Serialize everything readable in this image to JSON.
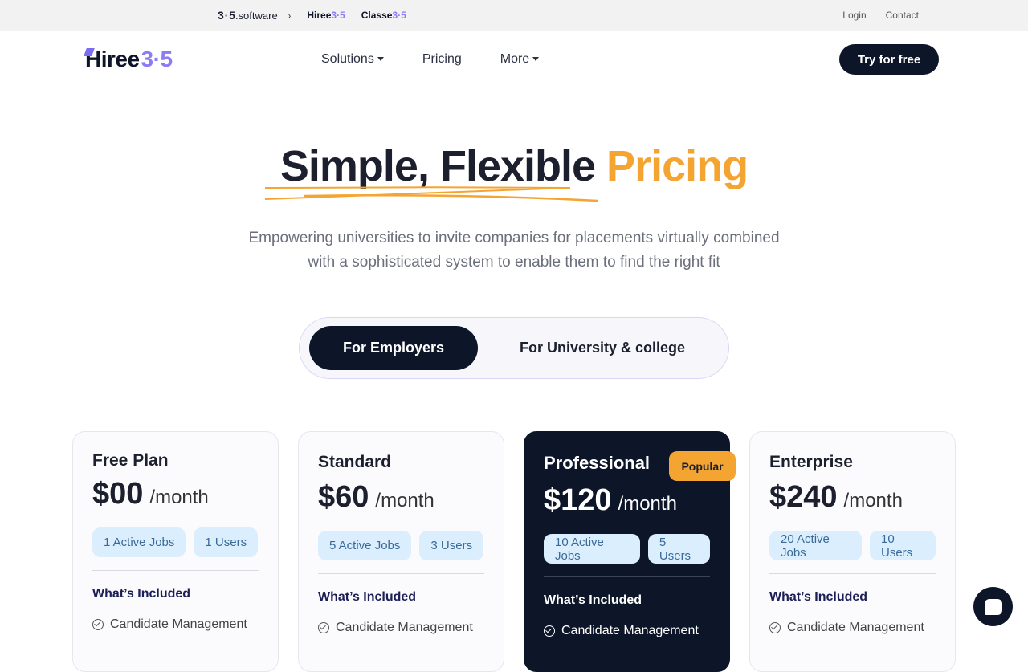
{
  "topbar": {
    "brand": {
      "digits_left": "3",
      "digits_right": "5",
      "suffix": ".software"
    },
    "chevron": "›",
    "products": [
      {
        "name": "Hiree",
        "suffix": "3·5"
      },
      {
        "name": "Classe",
        "suffix": "3·5"
      }
    ],
    "links": {
      "login": "Login",
      "contact": "Contact"
    }
  },
  "nav": {
    "logo": {
      "word": "Hiree",
      "digits": "3·5"
    },
    "menu": {
      "solutions": "Solutions",
      "pricing": "Pricing",
      "more": "More"
    },
    "cta": "Try for free"
  },
  "hero": {
    "title_main": "Simple, Flexible",
    "title_accent": "Pricing",
    "subtitle_line1": "Empowering universities to invite companies for placements virtually combined",
    "subtitle_line2": "with a sophisticated system to enable them to find the right fit"
  },
  "toggle": {
    "employers": "For Employers",
    "university": "For University & college"
  },
  "plans": [
    {
      "name": "Free Plan",
      "price": "$00",
      "period": "/month",
      "jobs": "1 Active Jobs",
      "users": "1 Users",
      "included": "What’s Included",
      "feature1": "Candidate Management"
    },
    {
      "name": "Standard",
      "price": "$60",
      "period": "/month",
      "jobs": "5 Active Jobs",
      "users": "3 Users",
      "included": "What’s Included",
      "feature1": "Candidate Management"
    },
    {
      "name": "Professional",
      "price": "$120",
      "period": "/month",
      "jobs": "10 Active Jobs",
      "users": "5 Users",
      "included": "What’s Included",
      "feature1": "Candidate Management",
      "badge": "Popular"
    },
    {
      "name": "Enterprise",
      "price": "$240",
      "period": "/month",
      "jobs": "20 Active Jobs",
      "users": "10 Users",
      "included": "What’s Included",
      "feature1": "Candidate Management"
    }
  ],
  "colors": {
    "navy": "#0d1529",
    "accent_orange": "#f4a531",
    "accent_purple": "#8b7cf6",
    "chip_blue": "#dbeefe"
  },
  "icons": {
    "chat": "chat-bubble-icon",
    "check": "check-circle-icon"
  }
}
